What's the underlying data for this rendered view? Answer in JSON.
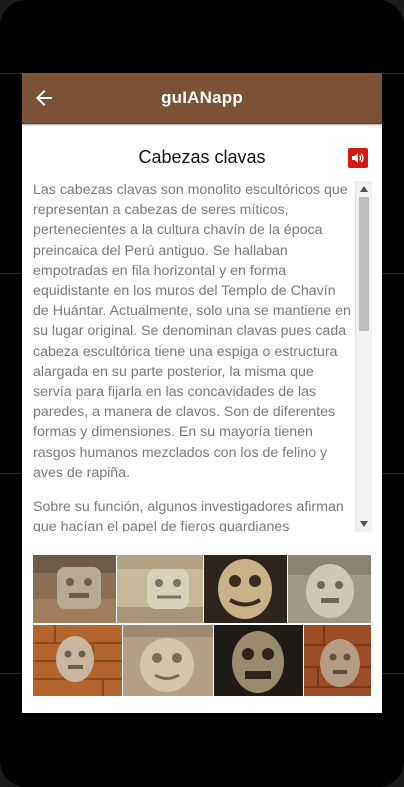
{
  "app": {
    "title": "guIANapp"
  },
  "article": {
    "heading": "Cabezas clavas",
    "paragraphs": [
      "Las cabezas clavas son monolito escultóricos que representan a cabezas de seres míticos, pertenecientes a la cultura chavín de la época preincaica del Perú antiguo. Se hallaban empotradas en fila horizontal y en forma equidistante en los muros del Templo de Chavín de Huántar. Actualmente, solo una se mantiene en su lugar original. Se denominan clavas pues cada cabeza escultórica tiene una espiga o estructura alargada en su parte posterior, la misma que servía para fijarla en las concavidades de las paredes, a manera de clavos. Son de diferentes formas y dimensiones. En su mayoría tienen rasgos humanos mezclados con los de felino y aves de rapiña.",
      "Sobre su función, algunos investigadores afirman que hacían el papel de fieros guardianes"
    ]
  },
  "icons": {
    "back": "arrow-left-icon",
    "audio": "speaker-icon",
    "scroll_up": "triangle-up-icon",
    "scroll_down": "triangle-down-icon"
  },
  "colors": {
    "appbar": "#7b5236",
    "audio_button": "#d21a13",
    "body_text": "#7a7a7a"
  },
  "gallery": {
    "photos": [
      "stone-head-photo-1",
      "stone-head-photo-2",
      "stone-head-photo-3",
      "stone-head-photo-4",
      "stone-head-photo-5",
      "stone-head-photo-6",
      "stone-head-photo-7",
      "stone-head-photo-8"
    ]
  }
}
